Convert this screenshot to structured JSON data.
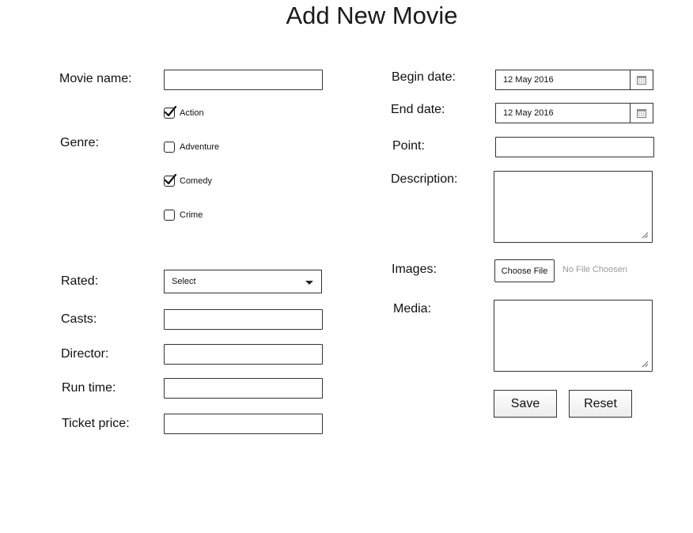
{
  "page": {
    "title": "Add New Movie"
  },
  "form_left": {
    "movie_name": {
      "label": "Movie name:",
      "value": ""
    },
    "genre": {
      "label": "Genre:",
      "options": [
        {
          "label": "Action",
          "checked": true
        },
        {
          "label": "Adventure",
          "checked": false
        },
        {
          "label": "Comedy",
          "checked": true
        },
        {
          "label": "Crime",
          "checked": false
        }
      ]
    },
    "rated": {
      "label": "Rated:",
      "selected": "Select"
    },
    "casts": {
      "label": "Casts:",
      "value": ""
    },
    "director": {
      "label": "Director:",
      "value": ""
    },
    "run_time": {
      "label": "Run time:",
      "value": ""
    },
    "ticket_price": {
      "label": "Ticket price:",
      "value": ""
    }
  },
  "form_right": {
    "begin_date": {
      "label": "Begin date:",
      "value": "12 May 2016"
    },
    "end_date": {
      "label": "End date:",
      "value": "12 May 2016"
    },
    "point": {
      "label": "Point:",
      "value": ""
    },
    "description": {
      "label": "Description:",
      "value": ""
    },
    "images": {
      "label": "Images:",
      "button_label": "Choose File",
      "status": "No File Choosen"
    },
    "media": {
      "label": "Media:",
      "value": ""
    }
  },
  "actions": {
    "save_label": "Save",
    "reset_label": "Reset"
  },
  "icons": {
    "calendar": "calendar-icon",
    "checkmark": "checkmark-icon",
    "dropdown": "chevron-down-icon",
    "resize": "resize-grip-icon"
  }
}
